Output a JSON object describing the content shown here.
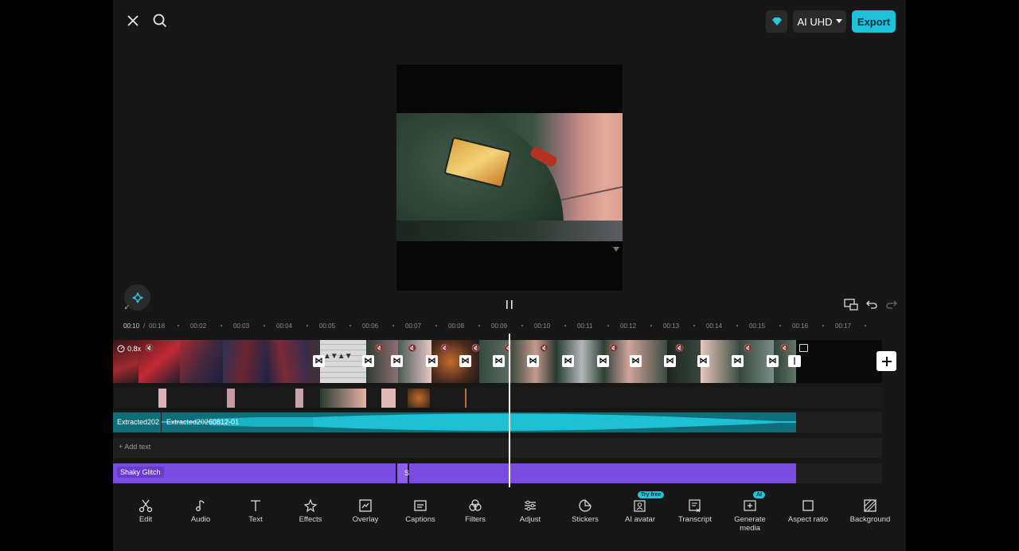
{
  "header": {
    "close_icon": "close-icon",
    "search_icon": "search-icon",
    "premium_icon": "diamond-icon",
    "resolution_label": "AI UHD",
    "export_label": "Export"
  },
  "controls": {
    "pause_icon": "pause-icon",
    "undo_icon": "undo-icon",
    "redo_icon": "redo-icon"
  },
  "timeline": {
    "current_time": "00:10",
    "separator": "/",
    "total_time": "00:18",
    "ticks": [
      "00:02",
      "00:03",
      "00:04",
      "00:05",
      "00:06",
      "00:07",
      "00:08",
      "00:09",
      "00:10",
      "00:11",
      "00:12",
      "00:13",
      "00:14",
      "00:15",
      "00:16",
      "00:17"
    ],
    "speed_label": "0.8x",
    "audio_label_1": "Extracted202",
    "audio_label_2": "Extracted20260812-01",
    "add_text_label": "Add text",
    "effect_label": "Shaky Glitch",
    "effect_label_short": "S"
  },
  "toolbar": {
    "items": [
      {
        "label": "Edit",
        "icon": "scissors-icon"
      },
      {
        "label": "Audio",
        "icon": "music-note-icon"
      },
      {
        "label": "Text",
        "icon": "text-icon"
      },
      {
        "label": "Effects",
        "icon": "sparkle-icon"
      },
      {
        "label": "Overlay",
        "icon": "overlay-icon"
      },
      {
        "label": "Captions",
        "icon": "captions-icon"
      },
      {
        "label": "Filters",
        "icon": "filters-icon"
      },
      {
        "label": "Adjust",
        "icon": "sliders-icon"
      },
      {
        "label": "Stickers",
        "icon": "sticker-icon"
      },
      {
        "label": "AI avatar",
        "icon": "avatar-icon"
      },
      {
        "label": "Transcript",
        "icon": "transcript-icon"
      },
      {
        "label": "Generate media",
        "icon": "generate-media-icon"
      },
      {
        "label": "Aspect ratio",
        "icon": "aspect-ratio-icon"
      },
      {
        "label": "Background",
        "icon": "background-icon"
      }
    ],
    "try_free_badge": "Try free",
    "ai_badge": "AI"
  },
  "colors": {
    "accent": "#1fc1d8",
    "effect_track": "#7b4ce0",
    "audio_track": "#0e6f7a",
    "background": "#171717"
  }
}
